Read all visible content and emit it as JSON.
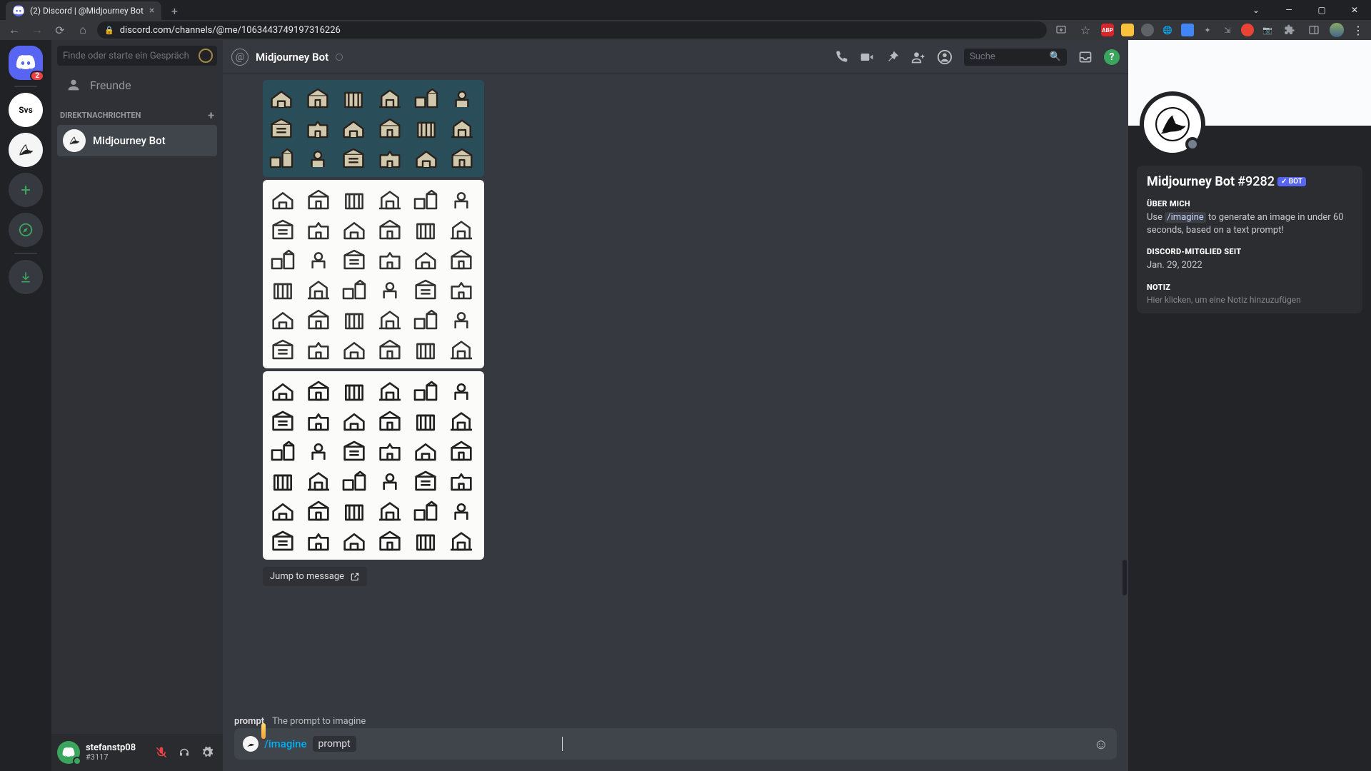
{
  "browser": {
    "tab_title": "(2) Discord | @Midjourney Bot",
    "url": "discord.com/channels/@me/1063443749197316226",
    "new_tab": "+",
    "window": {
      "min": "—",
      "max": "▢",
      "close": "✕"
    },
    "menu": "⋮"
  },
  "guild_bar": {
    "home_badge": "2",
    "svs_label": "Svs"
  },
  "dm_panel": {
    "search_placeholder": "Finde oder starte ein Gespräch",
    "friends_label": "Freunde",
    "dm_header": "DIREKTNACHRICHTEN",
    "items": [
      {
        "name": "Midjourney Bot"
      }
    ]
  },
  "user": {
    "name": "stefanstp08",
    "tag": "#3117"
  },
  "chat_header": {
    "title": "Midjourney Bot",
    "search_placeholder": "Suche"
  },
  "messages": {
    "jump_label": "Jump to message"
  },
  "composer": {
    "hint_label": "prompt",
    "hint_desc": "The prompt to imagine",
    "command": "/imagine",
    "param": "prompt"
  },
  "profile": {
    "name": "Midjourney Bot",
    "discrim": "#9282",
    "bot_badge": "✓ BOT",
    "about_h": "ÜBER MICH",
    "about_prefix": "Use ",
    "about_cmd": "/imagine",
    "about_suffix": " to generate an image in under 60 seconds, based on a text prompt!",
    "member_h": "DISCORD-MITGLIED SEIT",
    "member_date": "Jan. 29, 2022",
    "note_h": "NOTIZ",
    "note_placeholder": "Hier klicken, um eine Notiz hinzuzufügen"
  }
}
